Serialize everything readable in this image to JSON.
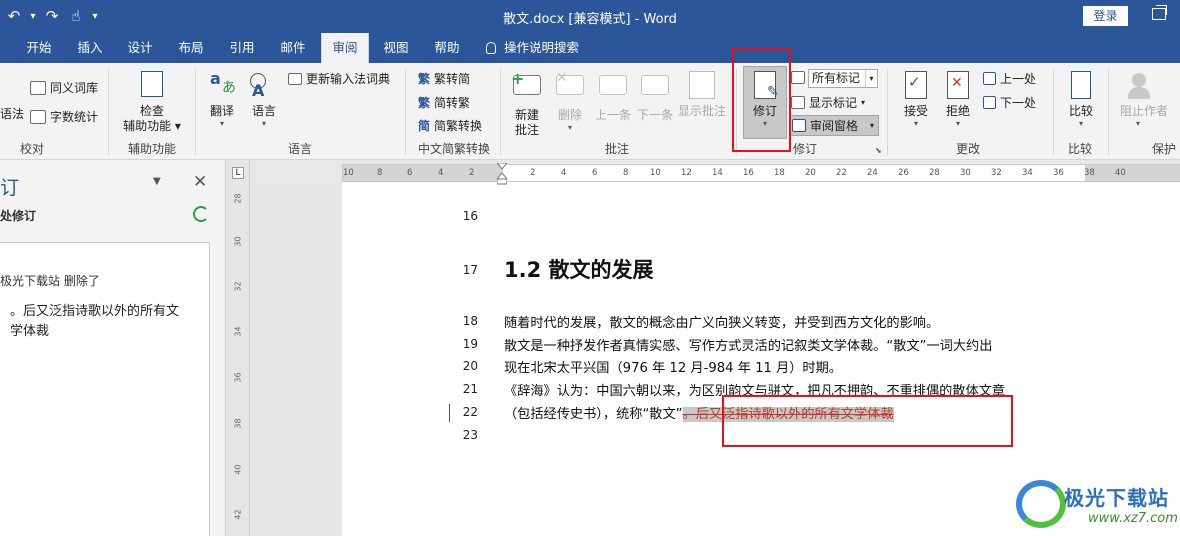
{
  "window": {
    "title": "散文.docx [兼容模式]  -  Word",
    "login_label": "登录",
    "qat": [
      "undo-icon",
      "redo-icon",
      "touch-mode-icon",
      "customize-icon"
    ]
  },
  "tabs": [
    "开始",
    "插入",
    "设计",
    "布局",
    "引用",
    "邮件",
    "审阅",
    "视图",
    "帮助",
    "操作说明搜索"
  ],
  "active_tab": "审阅",
  "ribbon": {
    "proofing": {
      "label": "校对",
      "grammar": "语法",
      "thesaurus": "同义词库",
      "word_count": "字数统计"
    },
    "accessibility": {
      "label": "辅助功能",
      "check_line1": "检查",
      "check_line2": "辅助功能"
    },
    "language": {
      "label": "语言",
      "translate": "翻译",
      "language": "语言",
      "update_ime": "更新输入法词典"
    },
    "chinese": {
      "label": "中文简繁转换",
      "to_simplified": "繁转简",
      "to_traditional": "简转繁",
      "convert": "简繁转换"
    },
    "comments": {
      "label": "批注",
      "new_line1": "新建",
      "new_line2": "批注",
      "delete": "删除",
      "previous": "上一条",
      "next": "下一条",
      "show": "显示批注"
    },
    "tracking": {
      "label": "修订",
      "track": "修订",
      "markup_select": "所有标记",
      "show_markup": "显示标记",
      "review_pane": "审阅窗格"
    },
    "changes": {
      "label": "更改",
      "accept": "接受",
      "reject": "拒绝",
      "previous": "上一处",
      "next": "下一处"
    },
    "compare": {
      "label": "比较",
      "compare": "比较"
    },
    "protect": {
      "label": "保护",
      "block_authors": "阻止作者"
    }
  },
  "pane": {
    "title": "订",
    "subtitle": "处修订",
    "author_line": "极光下载站  删除了",
    "deleted_text": "。后又泛指诗歌以外的所有文学体裁"
  },
  "vruler_ticks": [
    "28",
    "30",
    "32",
    "34",
    "36",
    "38",
    "40",
    "42"
  ],
  "hruler_ticks": [
    "10",
    "8",
    "6",
    "4",
    "2",
    "2",
    "4",
    "6",
    "8",
    "10",
    "12",
    "14",
    "16",
    "18",
    "20",
    "22",
    "24",
    "26",
    "28",
    "30",
    "32",
    "34",
    "36",
    "38",
    "40"
  ],
  "document": {
    "line_numbers": [
      "16",
      "17",
      "18",
      "19",
      "20",
      "21",
      "22",
      "23"
    ],
    "heading": "1.2 散文的发展",
    "lines": [
      "随着时代的发展，散文的概念由广义向狭义转变，并受到西方文化的影响。",
      "散文是一种抒发作者真情实感、写作方式灵活的记叙类文学体裁。“散文”一词大约出",
      "现在北宋太平兴国（976 年 12 月-984 年 11 月）时期。",
      "《辞海》认为：中国六朝以来，为区别韵文与骈文，把凡不押韵、不重排偶的散体文章"
    ],
    "line22_normal": "（包括经传史书），统称“散文”",
    "line22_deleted": "。后又泛指诗歌以外的所有文学体裁"
  },
  "watermark": {
    "name": "极光下载站",
    "url": "www.xz7.com"
  }
}
